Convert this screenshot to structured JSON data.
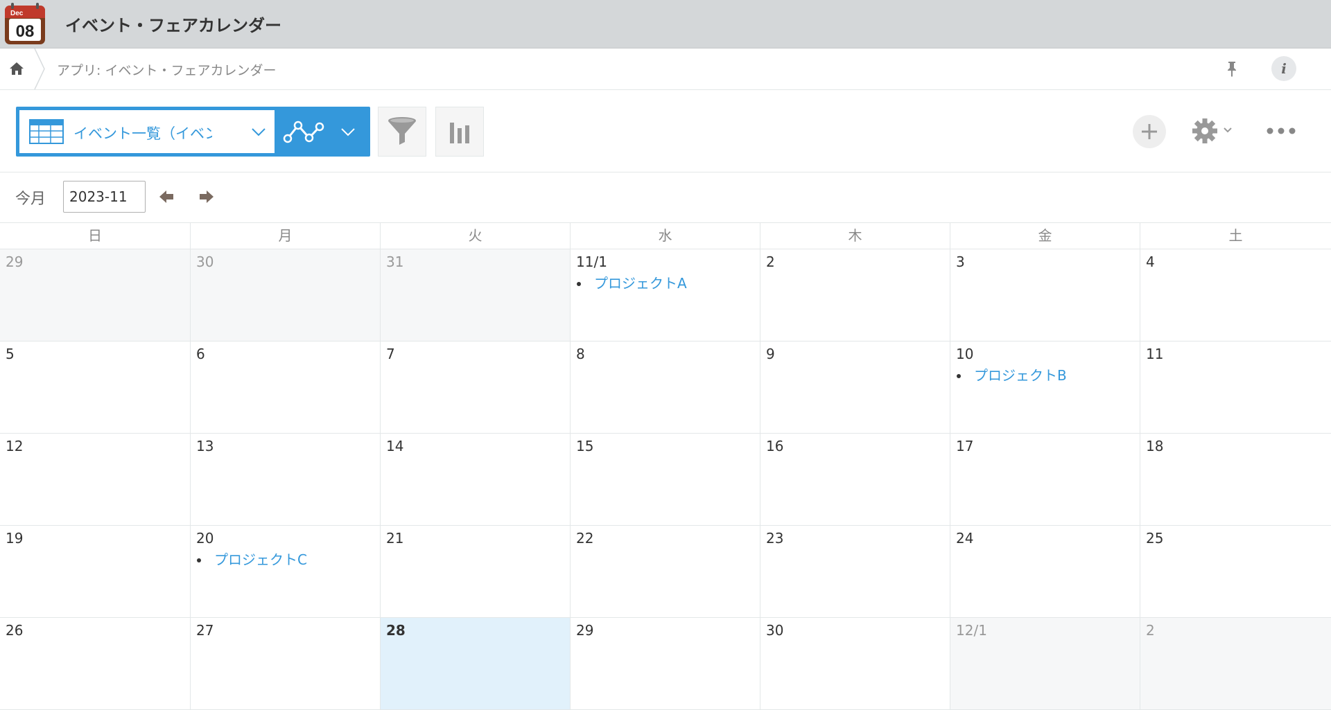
{
  "header": {
    "app_icon": {
      "name": "calendar-app-icon",
      "month": "Dec",
      "day": "08"
    },
    "title": "イベント・フェアカレンダー"
  },
  "breadcrumb": {
    "home_icon": "home-icon",
    "text": "アプリ: イベント・フェアカレンダー"
  },
  "toolbar": {
    "view_name": "イベント一覧（イベン…",
    "icons": [
      "table-icon",
      "line-graph-icon",
      "filter-icon",
      "bar-chart-icon",
      "plus-icon",
      "gear-icon",
      "more-icon"
    ],
    "accent_color": "#3498db"
  },
  "month_nav": {
    "label": "今月",
    "value": "2023-11"
  },
  "calendar": {
    "weekdays": [
      "日",
      "月",
      "火",
      "水",
      "木",
      "金",
      "土"
    ],
    "today_color": "#e1f1fb",
    "weeks": [
      [
        {
          "label": "29",
          "other": true,
          "events": []
        },
        {
          "label": "30",
          "other": true,
          "events": []
        },
        {
          "label": "31",
          "other": true,
          "events": []
        },
        {
          "label": "11/1",
          "events": [
            "プロジェクトA"
          ]
        },
        {
          "label": "2",
          "events": []
        },
        {
          "label": "3",
          "events": []
        },
        {
          "label": "4",
          "events": []
        }
      ],
      [
        {
          "label": "5",
          "events": []
        },
        {
          "label": "6",
          "events": []
        },
        {
          "label": "7",
          "events": []
        },
        {
          "label": "8",
          "events": []
        },
        {
          "label": "9",
          "events": []
        },
        {
          "label": "10",
          "events": [
            "プロジェクトB"
          ]
        },
        {
          "label": "11",
          "events": []
        }
      ],
      [
        {
          "label": "12",
          "events": []
        },
        {
          "label": "13",
          "events": []
        },
        {
          "label": "14",
          "events": []
        },
        {
          "label": "15",
          "events": []
        },
        {
          "label": "16",
          "events": []
        },
        {
          "label": "17",
          "events": []
        },
        {
          "label": "18",
          "events": []
        }
      ],
      [
        {
          "label": "19",
          "events": []
        },
        {
          "label": "20",
          "events": [
            "プロジェクトC"
          ]
        },
        {
          "label": "21",
          "events": []
        },
        {
          "label": "22",
          "events": []
        },
        {
          "label": "23",
          "events": []
        },
        {
          "label": "24",
          "events": []
        },
        {
          "label": "25",
          "events": []
        }
      ],
      [
        {
          "label": "26",
          "events": []
        },
        {
          "label": "27",
          "events": []
        },
        {
          "label": "28",
          "today": true,
          "events": []
        },
        {
          "label": "29",
          "events": []
        },
        {
          "label": "30",
          "events": []
        },
        {
          "label": "12/1",
          "other": true,
          "events": []
        },
        {
          "label": "2",
          "other": true,
          "events": []
        }
      ]
    ]
  }
}
